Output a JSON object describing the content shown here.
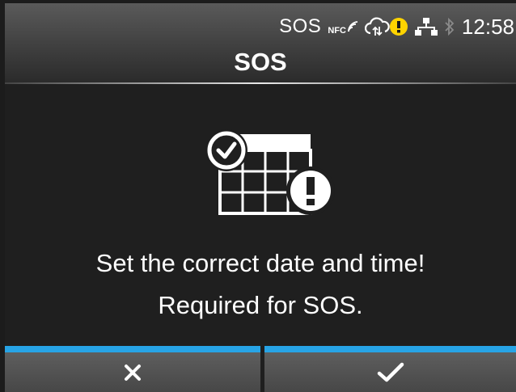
{
  "statusbar": {
    "sos": "SOS",
    "nfc": "NFC",
    "time": "12:58",
    "icons": [
      "nfc-icon",
      "cloud-sync-icon",
      "warning-icon",
      "network-icon",
      "bluetooth-icon"
    ]
  },
  "header": {
    "title": "SOS"
  },
  "message": {
    "line1": "Set the correct date and time!",
    "line2": "Required for SOS."
  },
  "footer": {
    "cancel_icon": "close-icon",
    "ok_icon": "check-icon",
    "accent_color": "#27a4e6"
  },
  "colors": {
    "warning": "#ffd400",
    "accent": "#27a4e6"
  }
}
